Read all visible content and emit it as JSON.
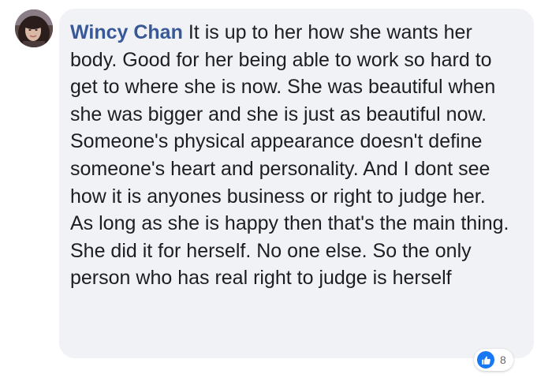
{
  "comment": {
    "author": "Wincy Chan",
    "body": "It is up to her how she wants her body. Good for her being able to work so hard to get to where she is now. She was beautiful when she was bigger and she is just as beautiful now. Someone's physical appearance doesn't define someone's heart and personality. And I dont see how it is anyones business or right to judge her.\nAs long as she is happy then that's the main thing. She did it for herself. No one else. So the only person who has real right to judge is herself"
  },
  "reactions": {
    "icon": "like-icon",
    "count": "8"
  },
  "colors": {
    "bubble_bg": "#f0f2f5",
    "author_link": "#385898",
    "text": "#1c1e21",
    "like_blue": "#1877f2",
    "count_gray": "#65676b"
  }
}
